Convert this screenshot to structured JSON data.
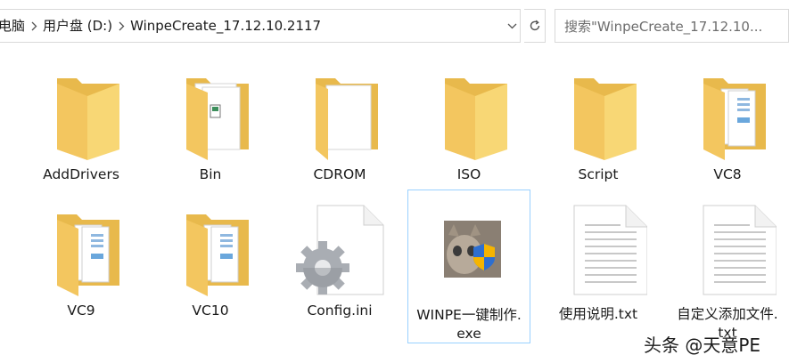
{
  "breadcrumb": {
    "items": [
      "电脑",
      "用户盘 (D:)",
      "WinpeCreate_17.12.10.2117"
    ]
  },
  "search": {
    "placeholder": "搜索\"WinpeCreate_17.12.10..."
  },
  "files": [
    {
      "name": "AddDrivers",
      "type": "folder"
    },
    {
      "name": "Bin",
      "type": "folder-doc"
    },
    {
      "name": "CDROM",
      "type": "folder-doc"
    },
    {
      "name": "ISO",
      "type": "folder"
    },
    {
      "name": "Script",
      "type": "folder"
    },
    {
      "name": "VC8",
      "type": "folder-doc"
    },
    {
      "name": "VC9",
      "type": "folder-doc"
    },
    {
      "name": "VC10",
      "type": "folder-doc"
    },
    {
      "name": "Config.ini",
      "type": "config"
    },
    {
      "name": "WINPE一键制作.",
      "name2": "exe",
      "type": "exe"
    },
    {
      "name": "使用说明.txt",
      "type": "txt"
    },
    {
      "name": "自定义添加文件.",
      "name2": "txt",
      "type": "txt"
    }
  ],
  "watermark": "头条 @天意PE",
  "colors": {
    "folder": "#f8d775",
    "folder_dark": "#e8b94c",
    "selection_border": "#99d1ff"
  }
}
